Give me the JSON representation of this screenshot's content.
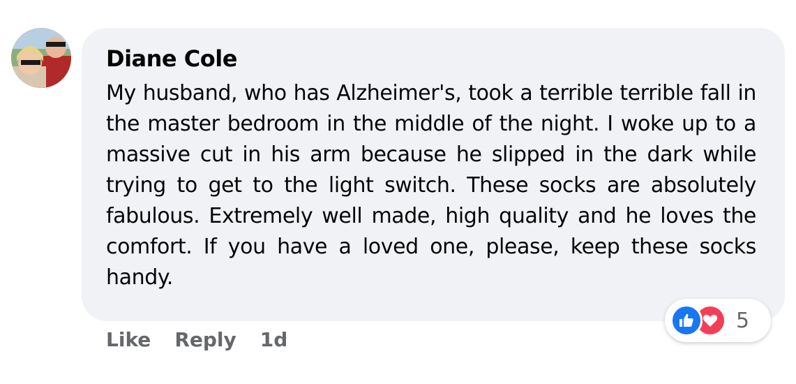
{
  "comment": {
    "author": "Diane Cole",
    "text": "My husband, who has Alzheimer's, took a terrible terrible fall in the master bedroom in the middle of the night. I woke up to a massive cut in his arm because he slipped in the dark while trying to get to the light switch. These socks are absolutely fabulous. Extremely well made, high quality and he loves the comfort. If you have a loved one, please, keep these socks handy.",
    "avatar_icon": "profile-photo",
    "actions": {
      "like_label": "Like",
      "reply_label": "Reply",
      "time": "1d"
    },
    "reactions": {
      "icons": [
        "thumbs-up-icon",
        "heart-icon"
      ],
      "colors": {
        "like": "#1877f2",
        "love": "#f33e58"
      },
      "count": "5"
    }
  }
}
